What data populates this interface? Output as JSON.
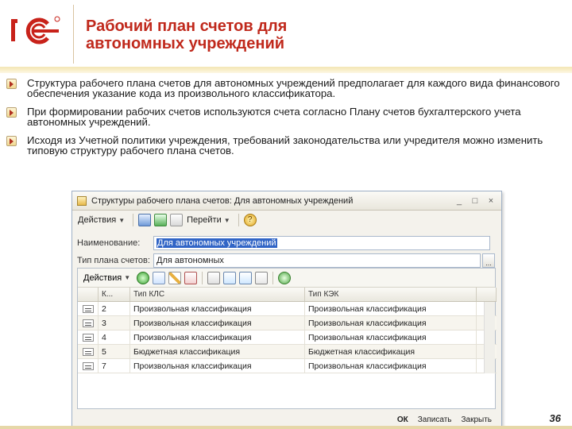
{
  "brand": {
    "logo_text": "1С",
    "registered": "®",
    "logo_color": "#c8221a"
  },
  "slide": {
    "title_line1": "Рабочий план счетов для",
    "title_line2": "автономных учреждений",
    "title_color": "#c0291c",
    "page_number": "36"
  },
  "bullets": [
    "Структура рабочего плана счетов для автономных учреждений предполагает для каждого вида финансового обеспечения указание кода из произвольного классификатора.",
    "При формировании рабочих счетов используются счета согласно Плану счетов бухгалтерского учета автономных учреждений.",
    "Исходя из Учетной политики учреждения, требований законодательства или учредителя можно изменить типовую структуру рабочего плана счетов."
  ],
  "window": {
    "title": "Структуры рабочего плана счетов: Для автономных учреждений",
    "toolbar": {
      "actions_label": "Действия",
      "goto_label": "Перейти"
    },
    "fields": {
      "name_label": "Наименование:",
      "name_value": "Для автономных учреждений",
      "type_label": "Тип плана счетов:",
      "type_value": "Для автономных"
    },
    "inner_toolbar": {
      "actions_label": "Действия"
    },
    "table": {
      "headers": [
        "К...",
        "Тип КЛС",
        "Тип КЭК"
      ],
      "rows": [
        {
          "code": "2",
          "kls": "Произвольная классификация",
          "kek": "Произвольная классификация"
        },
        {
          "code": "3",
          "kls": "Произвольная классификация",
          "kek": "Произвольная классификация"
        },
        {
          "code": "4",
          "kls": "Произвольная классификация",
          "kek": "Произвольная классификация"
        },
        {
          "code": "5",
          "kls": "Бюджетная классификация",
          "kek": "Бюджетная классификация"
        },
        {
          "code": "7",
          "kls": "Произвольная классификация",
          "kek": "Произвольная классификация"
        }
      ]
    },
    "footer": {
      "ok": "ОК",
      "save": "Записать",
      "close": "Закрыть"
    }
  },
  "icons": {
    "bullet": "bullet-arrow-icon",
    "window": "window-icon",
    "minimize": "minimize-icon",
    "maximize": "maximize-icon",
    "close": "close-icon",
    "help": "help-icon",
    "add": "add-icon",
    "copy": "copy-icon",
    "edit": "edit-icon",
    "delete": "delete-icon",
    "filter": "filter-icon",
    "refresh": "refresh-icon"
  }
}
